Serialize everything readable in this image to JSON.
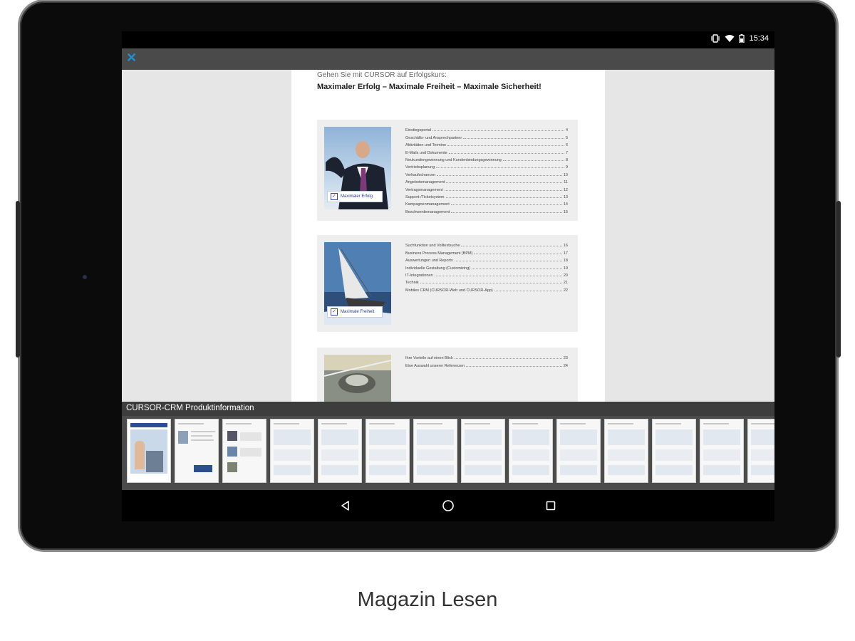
{
  "status_bar": {
    "time": "15:34",
    "icons": [
      "vibrate-icon",
      "wifi-icon",
      "battery-icon"
    ]
  },
  "app_bar": {
    "close_icon": "close-icon",
    "accent": "#1e90d6"
  },
  "document": {
    "kicker": "Gehen Sie mit CURSOR auf Erfolgskurs:",
    "title": "Maximaler Erfolg – Maximale Freiheit – Maximale Sicherheit!",
    "sections": [
      {
        "badge": "Maximaler Erfolg",
        "entries": [
          {
            "t": "Einstiegsportal",
            "n": "4"
          },
          {
            "t": "Geschäfts- und Ansprechpartner",
            "n": "5"
          },
          {
            "t": "Aktivitäten und Termine",
            "n": "6"
          },
          {
            "t": "E-Mails und Dokumente",
            "n": "7"
          },
          {
            "t": "Neukundengewinnung und Kundenbindungsgewinnung",
            "n": "8"
          },
          {
            "t": "Vertriebsplanung",
            "n": "9"
          },
          {
            "t": "Verkaufschancen",
            "n": "10"
          },
          {
            "t": "Angebotsmanagement",
            "n": "11"
          },
          {
            "t": "Vertragsmanagement",
            "n": "12"
          },
          {
            "t": "Support-/Ticketsystem",
            "n": "13"
          },
          {
            "t": "Kampagnenmanagement",
            "n": "14"
          },
          {
            "t": "Beschwerdemanagement",
            "n": "15"
          }
        ]
      },
      {
        "badge": "Maximale Freiheit",
        "entries": [
          {
            "t": "Suchfunktion und Volltextsuche",
            "n": "16"
          },
          {
            "t": "Business Process Management (BPM)",
            "n": "17"
          },
          {
            "t": "Auswertungen und Reports",
            "n": "18"
          },
          {
            "t": "Individuelle Gestaltung (Customizing)",
            "n": "19"
          },
          {
            "t": "IT-Integrationen",
            "n": "20"
          },
          {
            "t": "Technik",
            "n": "21"
          },
          {
            "t": "Mobiles CRM (CURSOR-Web und CURSOR-App)",
            "n": "22"
          }
        ]
      },
      {
        "badge": "",
        "entries": [
          {
            "t": "Ihre Vorteile auf einen Blick",
            "n": "23"
          },
          {
            "t": "Eine Auswahl unserer Referenzen",
            "n": "24"
          }
        ]
      }
    ]
  },
  "thumbnail_strip": {
    "title": "CURSOR-CRM Produktinformation",
    "pages": 14
  },
  "nav_bar": {
    "buttons": [
      "back-icon",
      "home-icon",
      "recents-icon"
    ]
  },
  "caption": "Magazin Lesen"
}
